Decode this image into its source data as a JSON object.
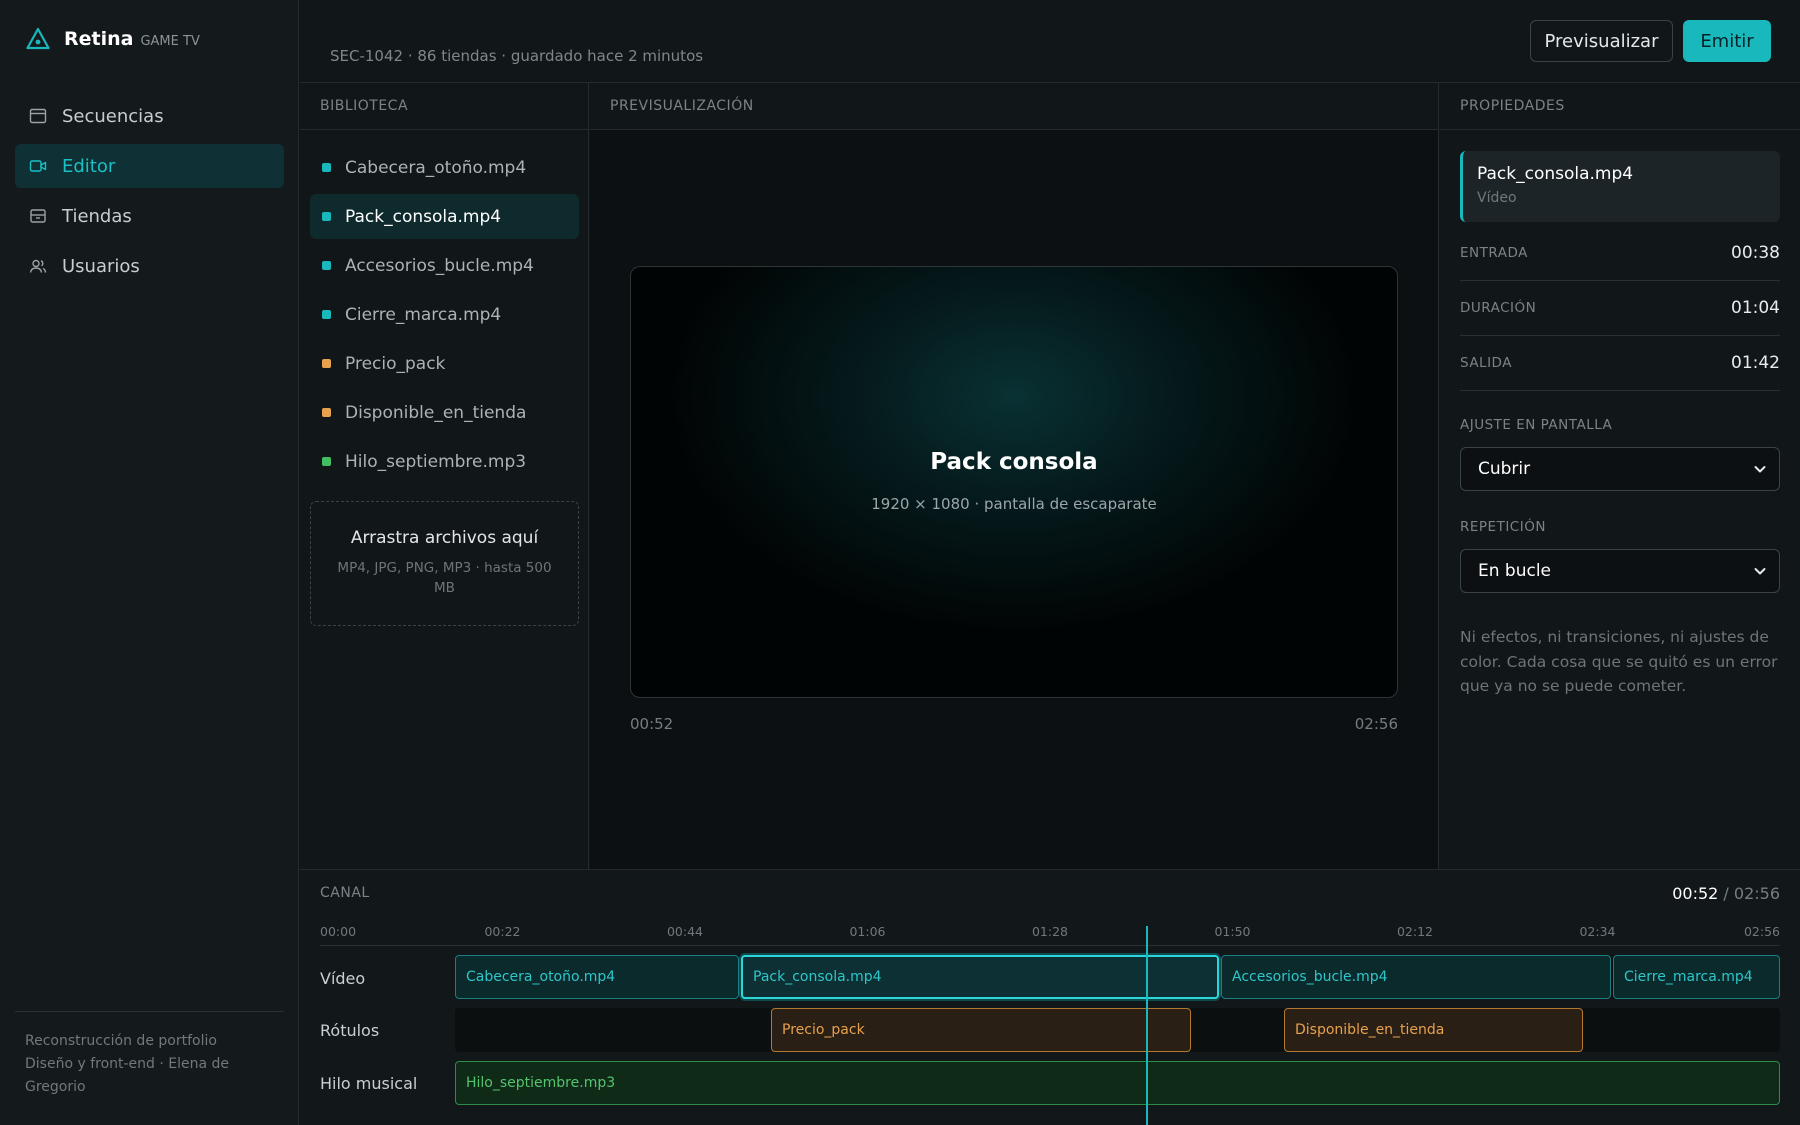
{
  "app": {
    "name": "Retina",
    "subtitle": "GAME TV"
  },
  "nav": [
    {
      "label": "Secuencias",
      "icon": "calendar-icon"
    },
    {
      "label": "Editor",
      "icon": "video-camera-icon",
      "active": true
    },
    {
      "label": "Tiendas",
      "icon": "store-icon"
    },
    {
      "label": "Usuarios",
      "icon": "users-icon"
    }
  ],
  "footer": {
    "line1": "Reconstrucción de portfolio",
    "line2": "Diseño y front-end · Elena de Gregorio"
  },
  "header": {
    "meta": "SEC-1042 · 86 tiendas · guardado hace 2 minutos",
    "preview_label": "Previsualizar",
    "emit_label": "Emitir"
  },
  "library": {
    "title": "BIBLIOTECA",
    "items": [
      {
        "name": "Cabecera_otoño.mp4",
        "color": "#19b8bd"
      },
      {
        "name": "Pack_consola.mp4",
        "color": "#19b8bd",
        "active": true
      },
      {
        "name": "Accesorios_bucle.mp4",
        "color": "#19b8bd"
      },
      {
        "name": "Cierre_marca.mp4",
        "color": "#19b8bd"
      },
      {
        "name": "Precio_pack",
        "color": "#e8a14d"
      },
      {
        "name": "Disponible_en_tienda",
        "color": "#e8a14d"
      },
      {
        "name": "Hilo_septiembre.mp3",
        "color": "#3fbf5f"
      }
    ],
    "dropzone": {
      "title": "Arrastra archivos aquí",
      "subtitle": "MP4, JPG, PNG, MP3 · hasta 500 MB"
    }
  },
  "preview": {
    "title": "PREVISUALIZACIÓN",
    "screen_title": "Pack consola",
    "screen_subtitle": "1920 × 1080 · pantalla de escaparate",
    "time_current": "00:52",
    "time_total": "02:56"
  },
  "properties": {
    "title": "PROPIEDADES",
    "selected_name": "Pack_consola.mp4",
    "selected_type": "Vídeo",
    "rows": [
      {
        "label": "ENTRADA",
        "value": "00:38"
      },
      {
        "label": "DURACIÓN",
        "value": "01:04"
      },
      {
        "label": "SALIDA",
        "value": "01:42"
      }
    ],
    "fit_label": "AJUSTE EN PANTALLA",
    "fit_value": "Cubrir",
    "repeat_label": "REPETICIÓN",
    "repeat_value": "En bucle",
    "note": "Ni efectos, ni transiciones, ni ajustes de color. Cada cosa que se quitó es un error que ya no se puede cometer."
  },
  "timeline": {
    "title": "CANAL",
    "current": "00:52",
    "separator": " / ",
    "total": "02:56",
    "ticks": [
      "00:00",
      "00:22",
      "00:44",
      "01:06",
      "01:28",
      "01:50",
      "02:12",
      "02:34",
      "02:56"
    ],
    "tracks": [
      {
        "label": "Vídeo",
        "type": "video",
        "clips": [
          {
            "name": "Cabecera_otoño.mp4"
          },
          {
            "name": "Pack_consola.mp4",
            "selected": true
          },
          {
            "name": "Accesorios_bucle.mp4"
          },
          {
            "name": "Cierre_marca.mp4"
          }
        ]
      },
      {
        "label": "Rótulos",
        "type": "label",
        "clips": [
          {
            "name": "Precio_pack"
          },
          {
            "name": "Disponible_en_tienda"
          }
        ]
      },
      {
        "label": "Hilo musical",
        "type": "audio",
        "clips": [
          {
            "name": "Hilo_septiembre.mp3"
          }
        ]
      }
    ]
  },
  "colors": {
    "accent": "#19b8bd",
    "video": "#19b8bd",
    "label": "#e8a14d",
    "audio": "#3fbf5f"
  }
}
